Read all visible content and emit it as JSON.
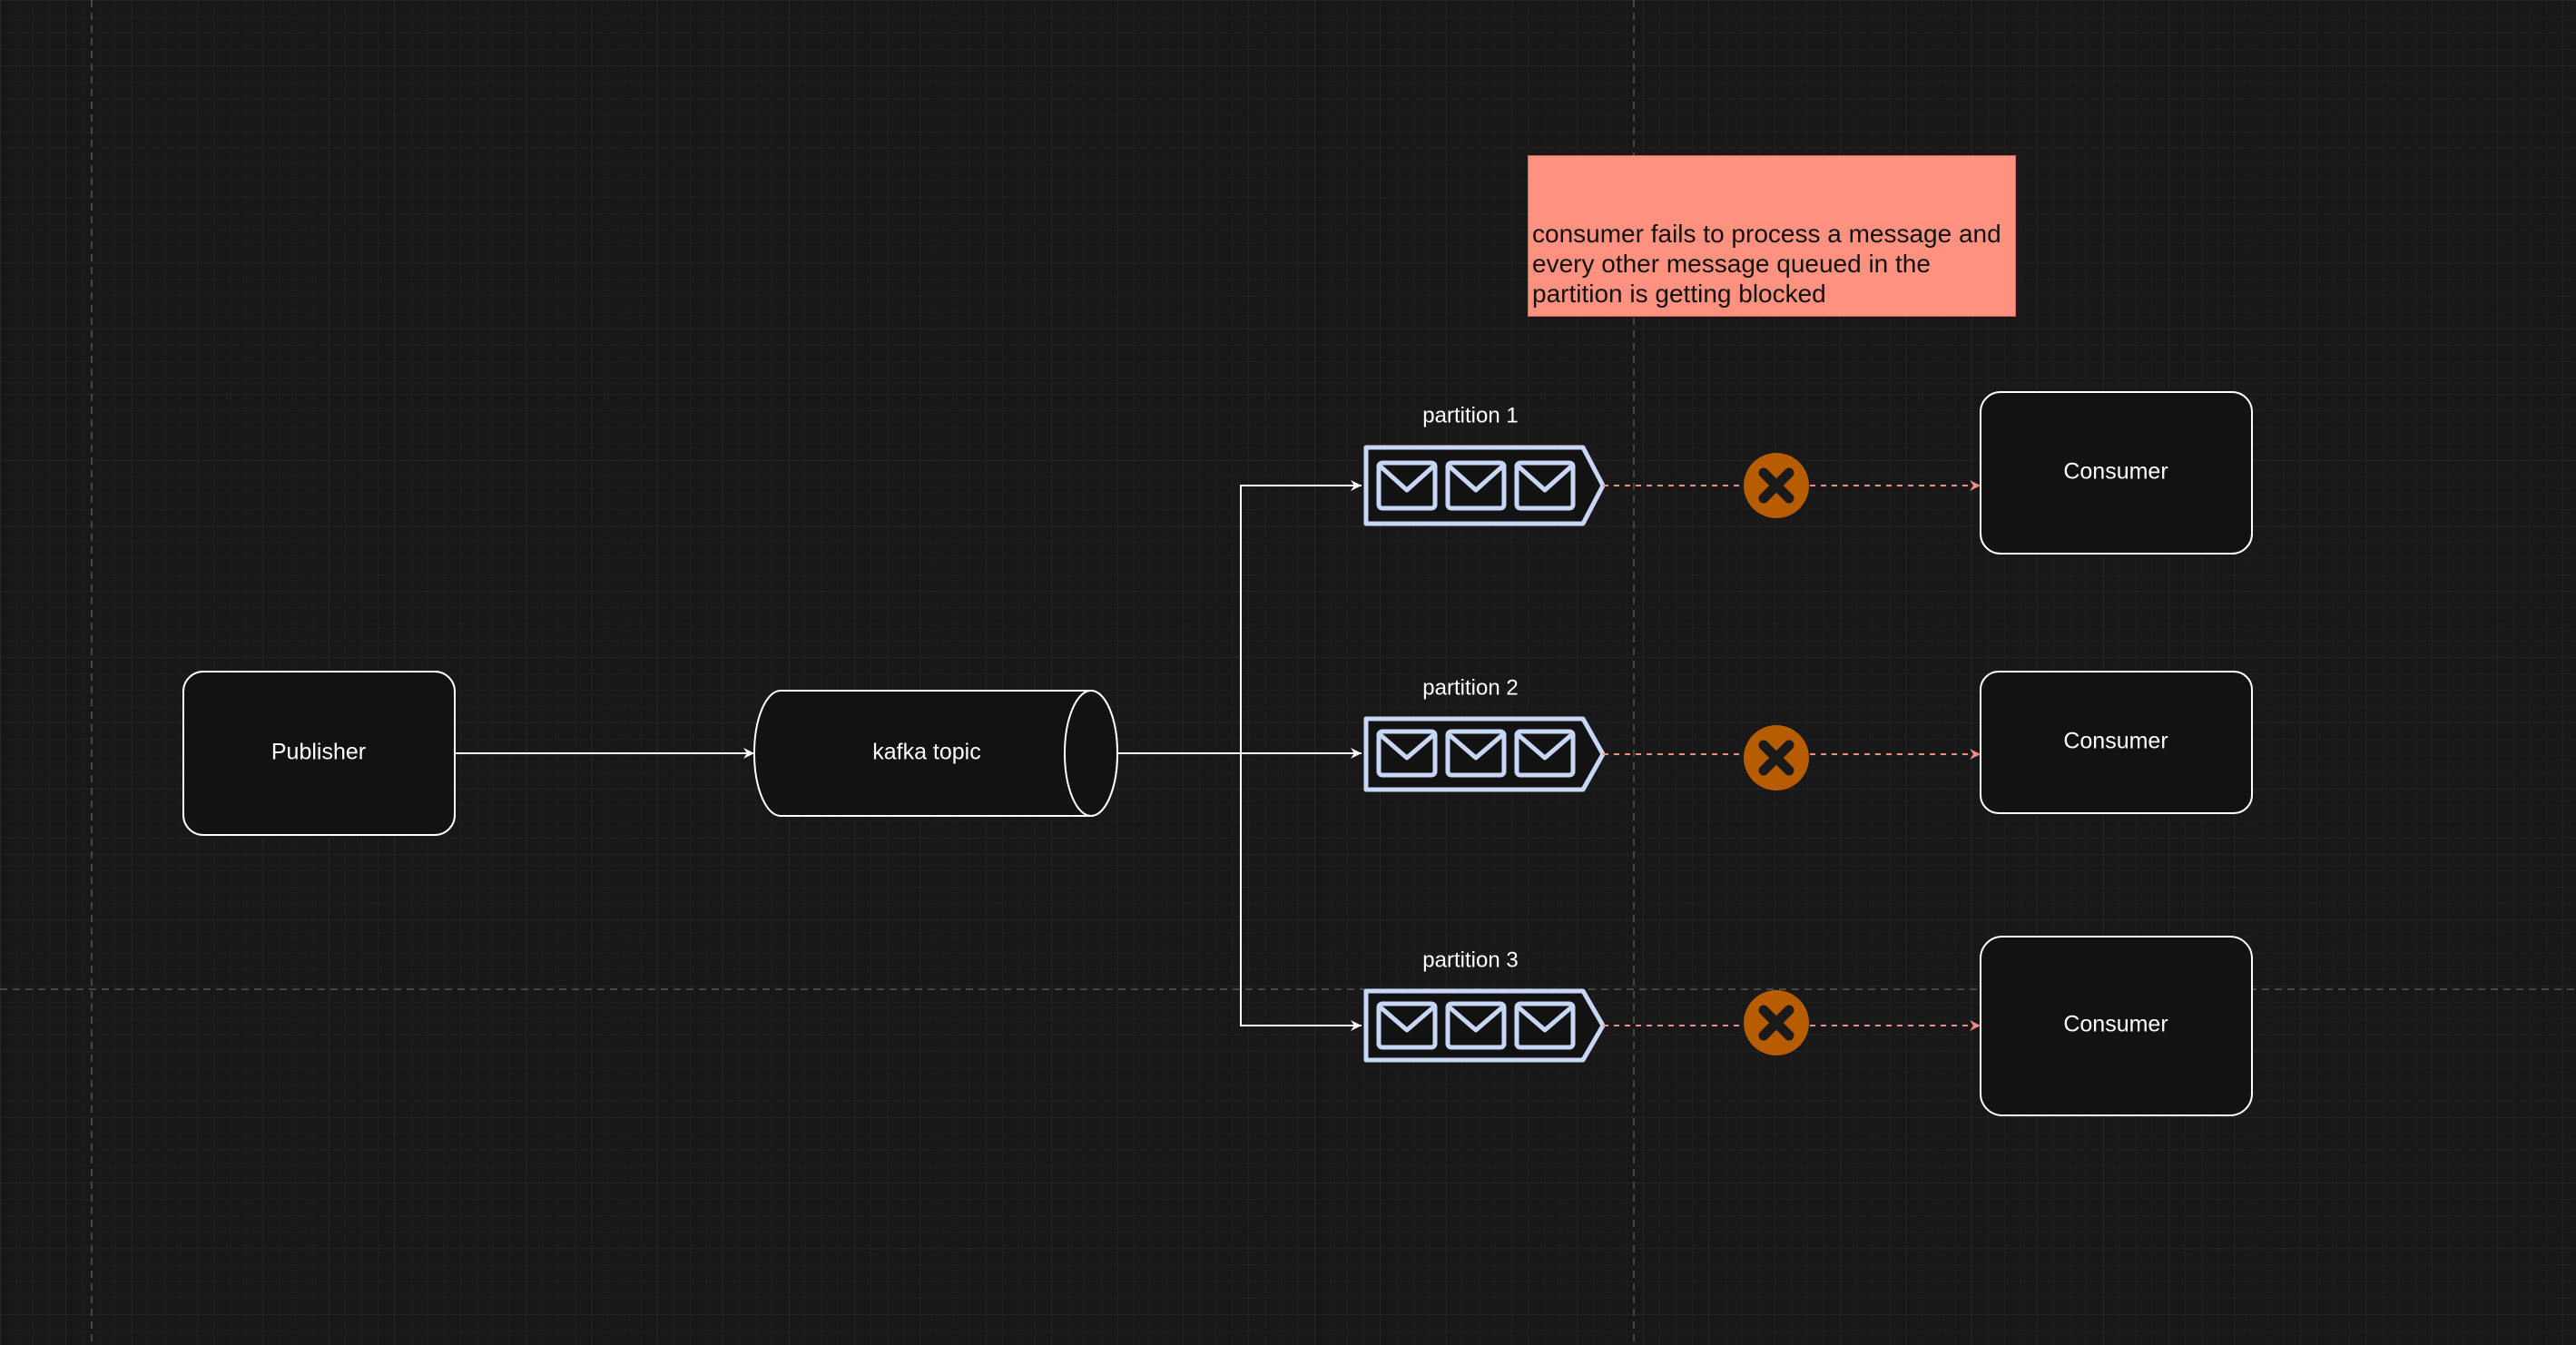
{
  "diagram": {
    "publisher_label": "Publisher",
    "topic_label": "kafka topic",
    "partitions": [
      {
        "label": "partition 1",
        "consumer_label": "Consumer"
      },
      {
        "label": "partition 2",
        "consumer_label": "Consumer"
      },
      {
        "label": "partition 3",
        "consumer_label": "Consumer"
      }
    ],
    "note": "consumer fails to process a message and\nevery other message queued in the\npartition is getting blocked"
  },
  "colors": {
    "background": "#181818",
    "stroke": "#ffffff",
    "queue": "#c7d7f5",
    "blocked_link": "#f28b82",
    "error_badge": "#b85c00",
    "note_fill": "#ff9180"
  },
  "icons": {
    "message": "envelope-icon",
    "error": "x-circle-icon"
  }
}
